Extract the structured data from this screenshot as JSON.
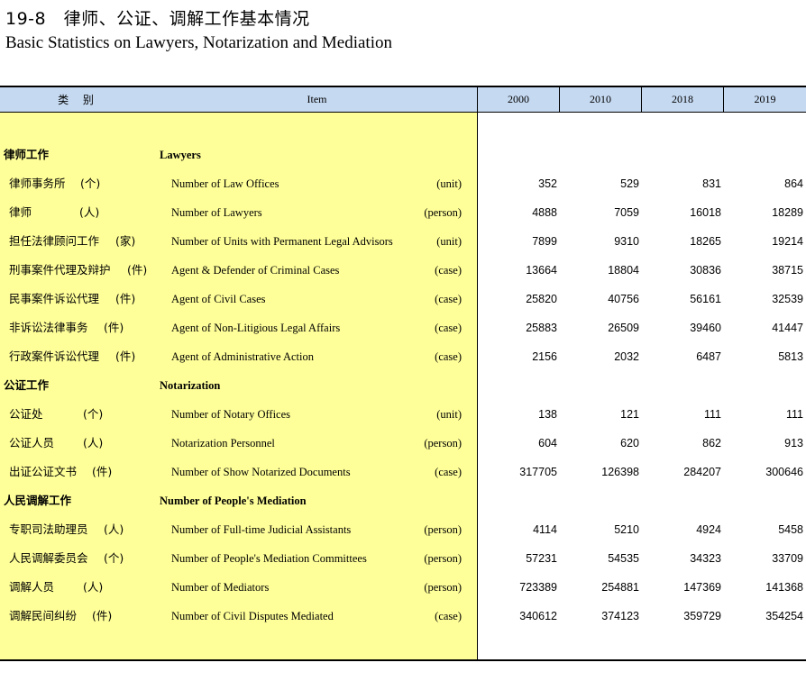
{
  "title": {
    "cn": "19-8　律师、公证、调解工作基本情况",
    "en": "Basic Statistics on Lawyers, Notarization and Mediation"
  },
  "header": {
    "category": "类 别",
    "item": "Item",
    "years": [
      "2000",
      "2010",
      "2018",
      "2019"
    ]
  },
  "sections": [
    {
      "cn": "律师工作",
      "en": "Lawyers",
      "rows": [
        {
          "cn": "律师事务所",
          "unit_cn": "(个)",
          "en": "Number of Law Offices",
          "unit": "(unit)",
          "values": [
            "352",
            "529",
            "831",
            "864"
          ]
        },
        {
          "cn": "律师",
          "unit_cn": "(人)",
          "en": "Number of Lawyers",
          "unit": "(person)",
          "values": [
            "4888",
            "7059",
            "16018",
            "18289"
          ]
        },
        {
          "cn": "担任法律顾问工作",
          "unit_cn": "(家)",
          "en": "Number of Units with Permanent Legal Advisors",
          "unit": "(unit)",
          "values": [
            "7899",
            "9310",
            "18265",
            "19214"
          ]
        },
        {
          "cn": "刑事案件代理及辩护",
          "unit_cn": "(件)",
          "en": "Agent & Defender of Criminal Cases",
          "unit": "(case)",
          "values": [
            "13664",
            "18804",
            "30836",
            "38715"
          ]
        },
        {
          "cn": "民事案件诉讼代理",
          "unit_cn": "(件)",
          "en": "Agent of Civil Cases",
          "unit": "(case)",
          "values": [
            "25820",
            "40756",
            "56161",
            "32539"
          ]
        },
        {
          "cn": "非诉讼法律事务",
          "unit_cn": "(件)",
          "en": "Agent of Non-Litigious Legal Affairs",
          "unit": "(case)",
          "values": [
            "25883",
            "26509",
            "39460",
            "41447"
          ]
        },
        {
          "cn": "行政案件诉讼代理",
          "unit_cn": "(件)",
          "en": "Agent of Administrative Action",
          "unit": "(case)",
          "values": [
            "2156",
            "2032",
            "6487",
            "5813"
          ]
        }
      ]
    },
    {
      "cn": "公证工作",
      "en": "Notarization",
      "rows": [
        {
          "cn": "公证处",
          "unit_cn": "(个)",
          "en": "Number of Notary Offices",
          "unit": "(unit)",
          "values": [
            "138",
            "121",
            "111",
            "111"
          ]
        },
        {
          "cn": "公证人员",
          "unit_cn": "(人)",
          "en": "Notarization Personnel",
          "unit": "(person)",
          "values": [
            "604",
            "620",
            "862",
            "913"
          ]
        },
        {
          "cn": "出证公证文书",
          "unit_cn": "(件)",
          "en": "Number of Show Notarized Documents",
          "unit": "(case)",
          "values": [
            "317705",
            "126398",
            "284207",
            "300646"
          ]
        }
      ]
    },
    {
      "cn": "人民调解工作",
      "en": "Number of People's Mediation",
      "rows": [
        {
          "cn": "专职司法助理员",
          "unit_cn": "(人)",
          "en": "Number of Full-time Judicial Assistants",
          "unit": "(person)",
          "values": [
            "4114",
            "5210",
            "4924",
            "5458"
          ]
        },
        {
          "cn": "人民调解委员会",
          "unit_cn": "(个)",
          "en": "Number of People's Mediation Committees",
          "unit": "(person)",
          "values": [
            "57231",
            "54535",
            "34323",
            "33709"
          ]
        },
        {
          "cn": "调解人员",
          "unit_cn": "(人)",
          "en": "Number of Mediators",
          "unit": "(person)",
          "values": [
            "723389",
            "254881",
            "147369",
            "141368"
          ]
        },
        {
          "cn": "调解民间纠纷",
          "unit_cn": "(件)",
          "en": "Number of Civil Disputes Mediated",
          "unit": "(case)",
          "values": [
            "340612",
            "374123",
            "359729",
            "354254"
          ]
        }
      ]
    }
  ]
}
